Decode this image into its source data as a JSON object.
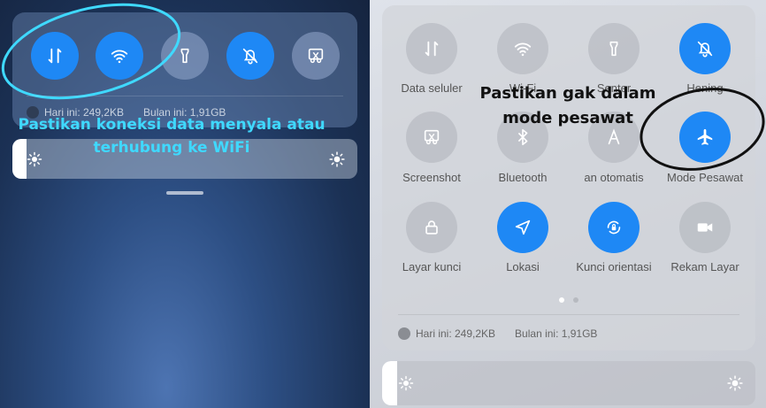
{
  "left_panel": {
    "usage": {
      "today": "Hari ini: 249,2KB",
      "month": "Bulan ini: 1,91GB"
    },
    "annotation": "Pastikan koneksi data menyala atau terhubung ke WiFi",
    "tiles": [
      {
        "name": "mobile-data",
        "icon": "arrows-up-down-icon",
        "active": true
      },
      {
        "name": "wifi",
        "icon": "wifi-icon",
        "active": true
      },
      {
        "name": "flashlight",
        "icon": "flashlight-icon",
        "active": false
      },
      {
        "name": "silent",
        "icon": "bell-off-icon",
        "active": true
      },
      {
        "name": "screenshot",
        "icon": "scissors-icon",
        "active": false
      }
    ]
  },
  "right_panel": {
    "annotation": "Pastikan gak dalam mode pesawat",
    "tiles": [
      {
        "label": "Data seluler",
        "icon": "arrows-up-down-icon",
        "active": false
      },
      {
        "label": "Wi-Fi",
        "icon": "wifi-icon",
        "active": false
      },
      {
        "label": "Senter",
        "icon": "flashlight-icon",
        "active": false
      },
      {
        "label": "Hening",
        "icon": "bell-off-icon",
        "active": true
      },
      {
        "label": "Screenshot",
        "icon": "scissors-icon",
        "active": false
      },
      {
        "label": "Bluetooth",
        "icon": "bluetooth-icon",
        "active": false
      },
      {
        "label": "an otomatis",
        "icon": "auto-brightness-icon",
        "active": false
      },
      {
        "label": "Mode Pesawat",
        "icon": "airplane-icon",
        "active": true
      },
      {
        "label": "Layar kunci",
        "icon": "lock-icon",
        "active": false
      },
      {
        "label": "Lokasi",
        "icon": "location-icon",
        "active": true
      },
      {
        "label": "Kunci orientasi",
        "icon": "rotation-lock-icon",
        "active": true
      },
      {
        "label": "Rekam Layar",
        "icon": "video-camera-icon",
        "active": false
      }
    ],
    "usage": {
      "today": "Hari ini: 249,2KB",
      "month": "Bulan ini: 1,91GB"
    },
    "page_indicator": {
      "pages": 2,
      "current": 1
    }
  },
  "brightness_level": 0.04,
  "colors": {
    "accent": "#1e88f5",
    "annotation_cyan": "#3fd9ff"
  }
}
